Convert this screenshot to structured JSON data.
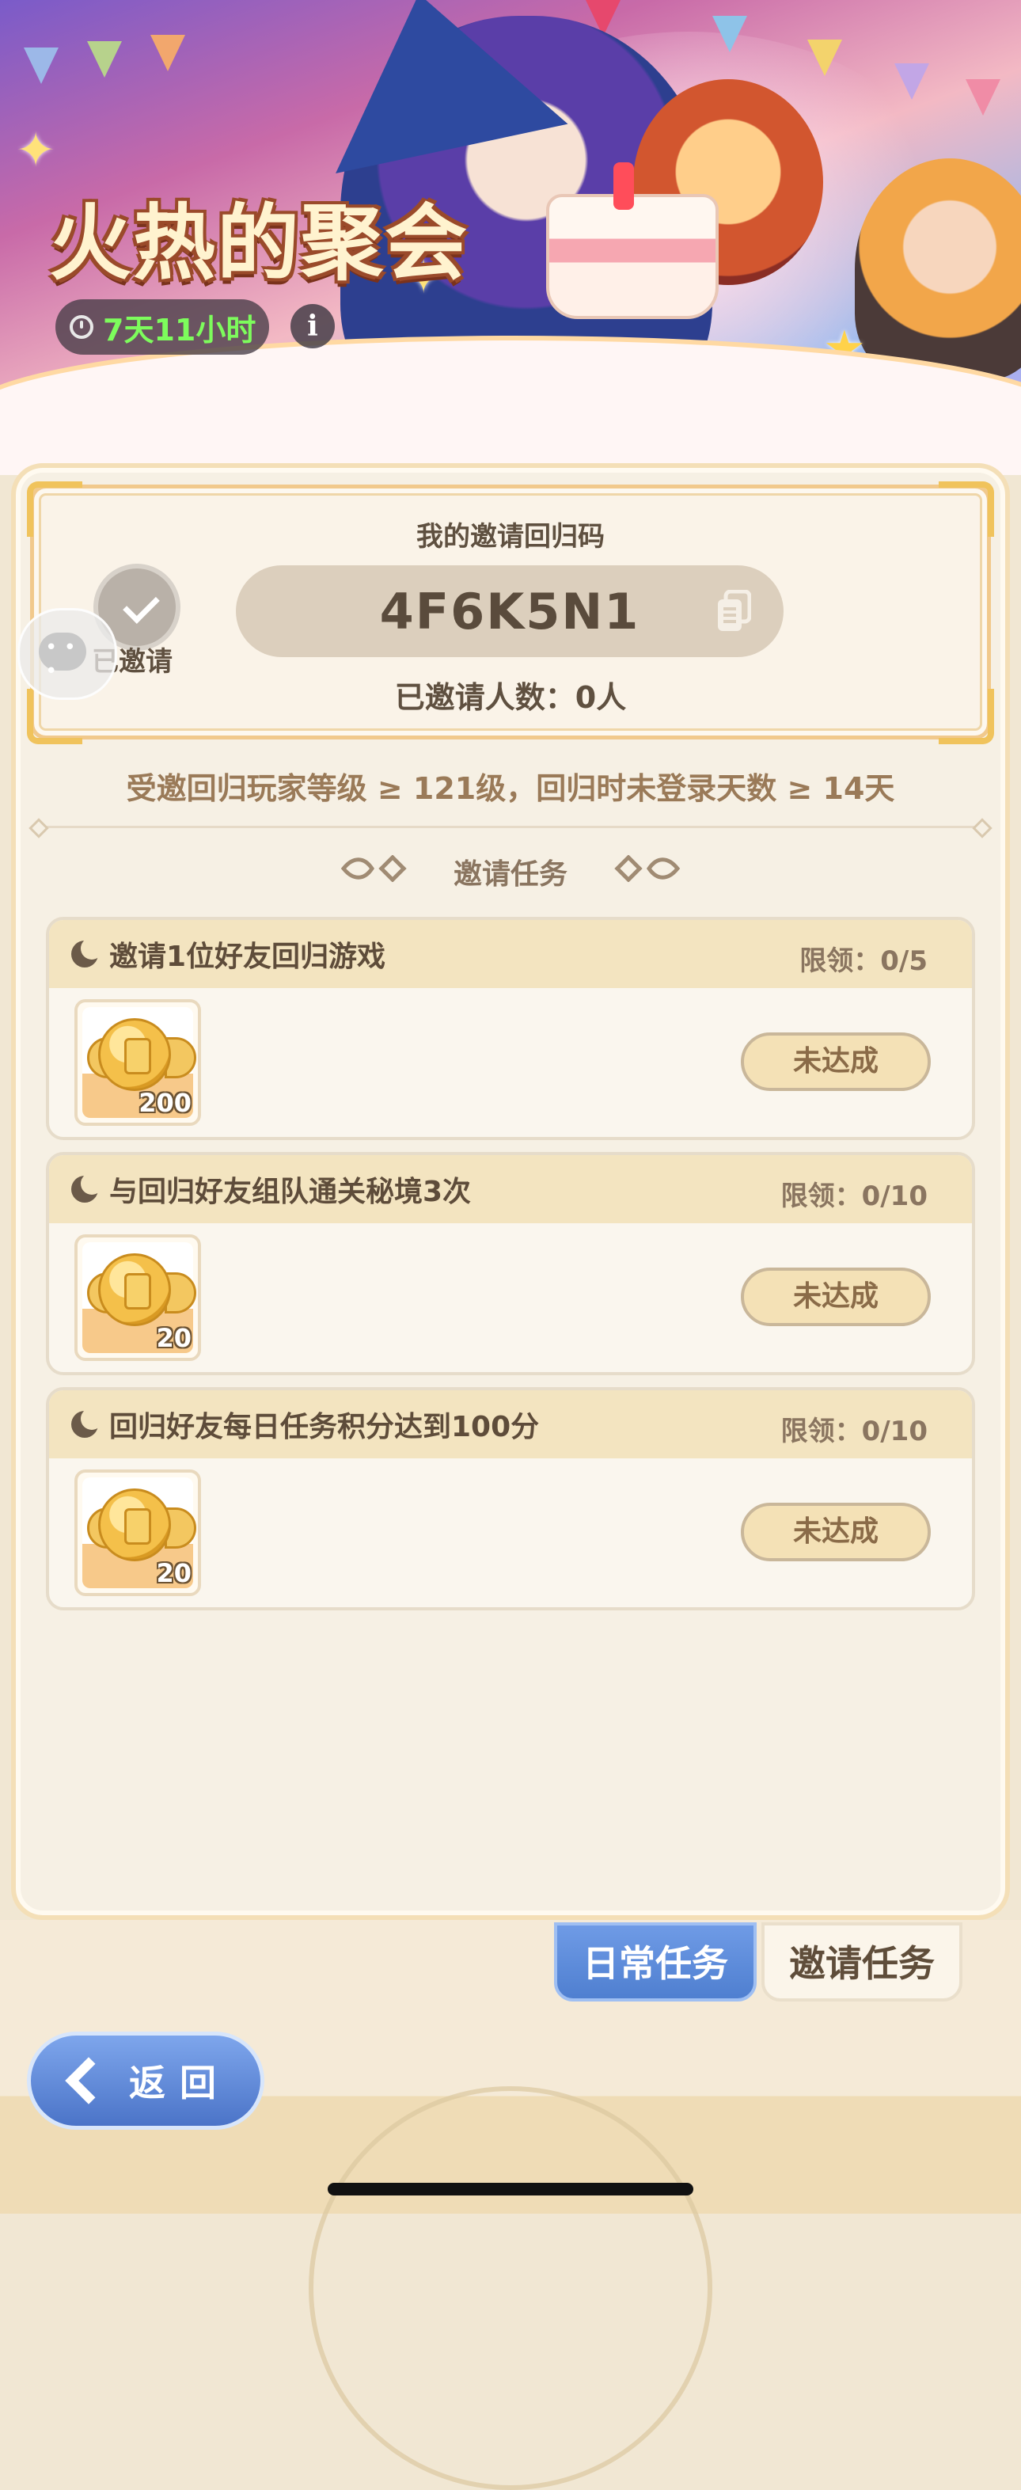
{
  "event": {
    "title": "火热的聚会",
    "countdown": "7天11小时",
    "info_label": "i"
  },
  "invite_card": {
    "code_label": "我的邀请回归码",
    "code": "4F6K5N1",
    "invited_count": "已邀请人数：0人",
    "invited_badge_label": "已邀请"
  },
  "requirement": "受邀回归玩家等级 ≥ 121级，回归时未登录天数 ≥ 14天",
  "section_title": "邀请任务",
  "tasks": [
    {
      "name": "邀请1位好友回归游戏",
      "limit": "限领：0/5",
      "reward_qty": "200",
      "status": "未达成"
    },
    {
      "name": "与回归好友组队通关秘境3次",
      "limit": "限领：0/10",
      "reward_qty": "20",
      "status": "未达成"
    },
    {
      "name": "回归好友每日任务积分达到100分",
      "limit": "限领：0/10",
      "reward_qty": "20",
      "status": "未达成"
    }
  ],
  "tabs": {
    "daily": "日常任务",
    "invite": "邀请任务"
  },
  "back_button": "返回",
  "colors": {
    "accent_blue": "#4f7fd0",
    "timer_green": "#7dfc5c",
    "gold": "#f0c35c"
  },
  "icons": [
    "clock-icon",
    "info-icon",
    "copy-icon",
    "checkmark-icon",
    "chat-icon",
    "moon-icon",
    "coin-reward-icon",
    "back-chevron-icon"
  ]
}
